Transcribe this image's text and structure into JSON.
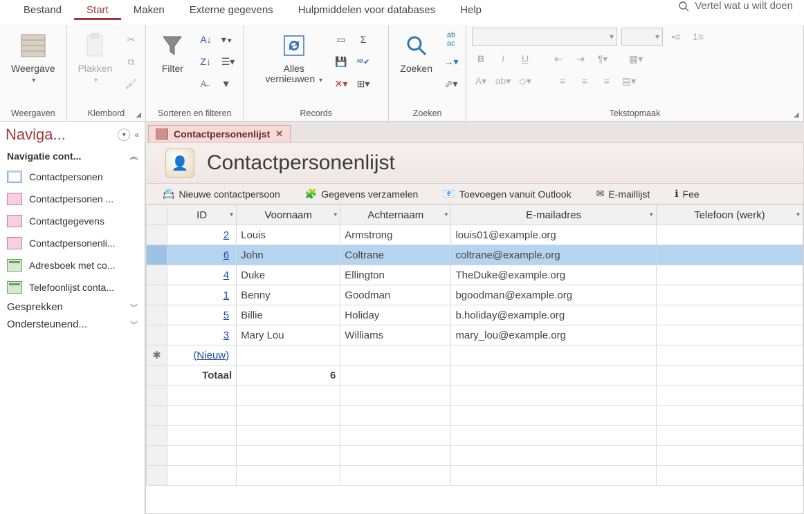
{
  "menu": {
    "items": [
      "Bestand",
      "Start",
      "Maken",
      "Externe gegevens",
      "Hulpmiddelen voor databases",
      "Help"
    ],
    "active_index": 1,
    "tell_me": "Vertel wat u wilt doen"
  },
  "ribbon": {
    "groups": {
      "weergaven": {
        "label": "Weergaven",
        "button": "Weergave"
      },
      "klembord": {
        "label": "Klembord",
        "button": "Plakken"
      },
      "sorteren": {
        "label": "Sorteren en filteren",
        "button": "Filter"
      },
      "records": {
        "label": "Records",
        "button_line1": "Alles",
        "button_line2": "vernieuwen"
      },
      "zoeken": {
        "label": "Zoeken",
        "button": "Zoeken"
      },
      "tekstopmaak": {
        "label": "Tekstopmaak"
      }
    }
  },
  "nav": {
    "title": "Naviga...",
    "subtitle": "Navigatie cont...",
    "items": [
      {
        "label": "Contactpersonen",
        "icon": "table"
      },
      {
        "label": "Contactpersonen ...",
        "icon": "form-pink"
      },
      {
        "label": "Contactgegevens",
        "icon": "form-pink"
      },
      {
        "label": "Contactpersonenli...",
        "icon": "form-pink"
      },
      {
        "label": "Adresboek met co...",
        "icon": "report"
      },
      {
        "label": "Telefoonlijst conta...",
        "icon": "report"
      }
    ],
    "sections": [
      "Gesprekken",
      "Ondersteunend..."
    ]
  },
  "tab": {
    "label": "Contactpersonenlijst"
  },
  "form": {
    "title": "Contactpersonenlijst",
    "actions": [
      "Nieuwe contactpersoon",
      "Gegevens verzamelen",
      "Toevoegen vanuit Outlook",
      "E-maillijst",
      "Fee"
    ]
  },
  "grid": {
    "columns": [
      "ID",
      "Voornaam",
      "Achternaam",
      "E-mailadres",
      "Telefoon (werk)"
    ],
    "rows": [
      {
        "id": "2",
        "voornaam": "Louis",
        "achternaam": "Armstrong",
        "email": "louis01@example.org",
        "tel": ""
      },
      {
        "id": "6",
        "voornaam": "John",
        "achternaam": "Coltrane",
        "email": "coltrane@example.org",
        "tel": "",
        "selected": true
      },
      {
        "id": "4",
        "voornaam": "Duke",
        "achternaam": "Ellington",
        "email": "TheDuke@example.org",
        "tel": ""
      },
      {
        "id": "1",
        "voornaam": "Benny",
        "achternaam": "Goodman",
        "email": "bgoodman@example.org",
        "tel": ""
      },
      {
        "id": "5",
        "voornaam": "Billie",
        "achternaam": "Holiday",
        "email": "b.holiday@example.org",
        "tel": ""
      },
      {
        "id": "3",
        "voornaam": "Mary Lou",
        "achternaam": "Williams",
        "email": "mary_lou@example.org",
        "tel": ""
      }
    ],
    "new_row_label": "(Nieuw)",
    "total_label": "Totaal",
    "total_value": "6"
  }
}
